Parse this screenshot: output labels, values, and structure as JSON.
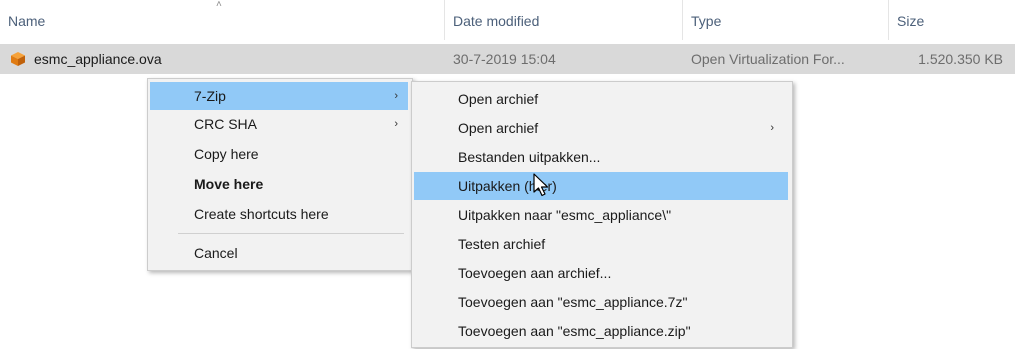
{
  "header": {
    "columns": {
      "name": "Name",
      "date": "Date modified",
      "type": "Type",
      "size": "Size"
    },
    "sort_indicator": "˄"
  },
  "file": {
    "name": "esmc_appliance.ova",
    "date": "30-7-2019 15:04",
    "type": "Open Virtualization For...",
    "size": "1.520.350 KB",
    "icon": "package-icon",
    "icon_colors": {
      "top": "#f6a23a",
      "left": "#e07b12",
      "right": "#c0610a"
    }
  },
  "context_menu": {
    "items": [
      {
        "label": "7-Zip",
        "has_submenu": true,
        "highlighted": true
      },
      {
        "label": "CRC SHA",
        "has_submenu": true
      },
      {
        "label": "Copy here"
      },
      {
        "label": "Move here",
        "bold": true
      },
      {
        "label": "Create shortcuts here"
      },
      {
        "label": "Cancel"
      }
    ],
    "chevron": "›"
  },
  "submenu": {
    "items": [
      {
        "label": "Open archief"
      },
      {
        "label": "Open archief",
        "has_submenu": true
      },
      {
        "label": "Bestanden uitpakken..."
      },
      {
        "label": "Uitpakken (hier)",
        "highlighted": true
      },
      {
        "label": "Uitpakken naar \"esmc_appliance\\\""
      },
      {
        "label": "Testen archief"
      },
      {
        "label": "Toevoegen aan archief..."
      },
      {
        "label": "Toevoegen aan \"esmc_appliance.7z\""
      },
      {
        "label": "Toevoegen aan \"esmc_appliance.zip\""
      }
    ]
  },
  "colors": {
    "selected_row": "#d9d9d9",
    "menu_highlight": "#91c9f7",
    "menu_background": "#f2f2f2",
    "header_text": "#4c607a"
  }
}
